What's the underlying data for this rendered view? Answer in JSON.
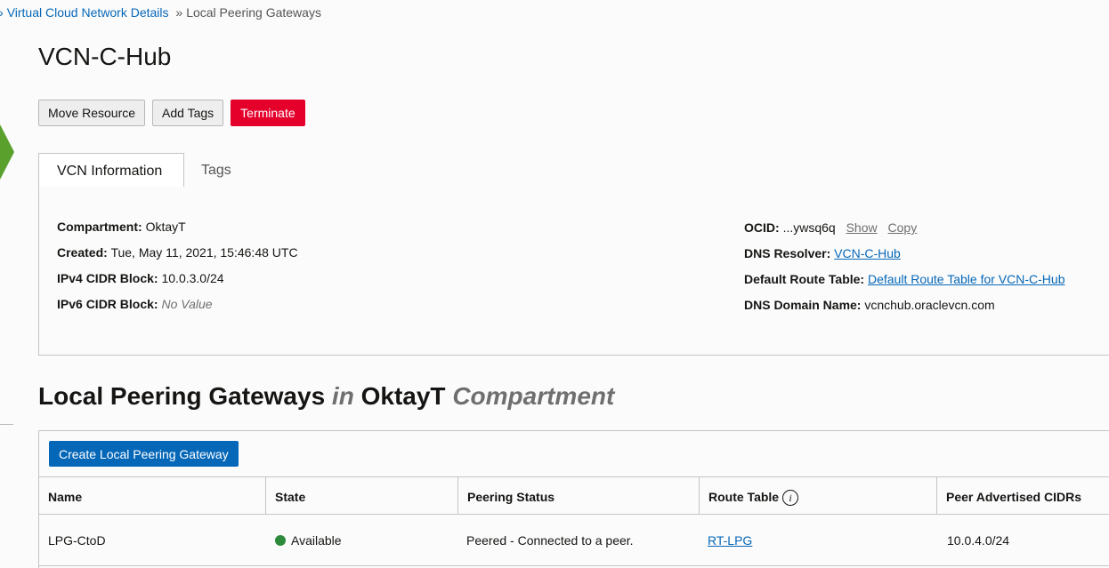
{
  "breadcrumb": {
    "prefix": "»",
    "parent": "Virtual Cloud Network Details",
    "separator": "»",
    "current": "Local Peering Gateways"
  },
  "page": {
    "title": "VCN-C-Hub"
  },
  "actions": {
    "move": "Move Resource",
    "tags": "Add Tags",
    "terminate": "Terminate"
  },
  "tabs": [
    {
      "label": "VCN Information",
      "active": true
    },
    {
      "label": "Tags",
      "active": false
    }
  ],
  "vcn_info": {
    "compartment": {
      "label": "Compartment:",
      "value": "OktayT"
    },
    "created": {
      "label": "Created:",
      "value": "Tue, May 11, 2021, 15:46:48 UTC"
    },
    "ipv4": {
      "label": "IPv4 CIDR Block:",
      "value": "10.0.3.0/24"
    },
    "ipv6": {
      "label": "IPv6 CIDR Block:",
      "value": "No Value"
    },
    "ocid": {
      "label": "OCID:",
      "value": "...ywsq6q",
      "show": "Show",
      "copy": "Copy"
    },
    "dns_resolver": {
      "label": "DNS Resolver:",
      "value": "VCN-C-Hub"
    },
    "route_table": {
      "label": "Default Route Table:",
      "value": "Default Route Table for VCN-C-Hub"
    },
    "dns_domain": {
      "label": "DNS Domain Name:",
      "value": "vcnchub.oraclevcn.com"
    }
  },
  "section": {
    "title": "Local Peering Gateways",
    "in": "in",
    "compartment": "OktayT",
    "suffix": "Compartment"
  },
  "create_button": "Create Local Peering Gateway",
  "table": {
    "columns": [
      "Name",
      "State",
      "Peering Status",
      "Route Table",
      "Peer Advertised CIDRs"
    ],
    "info_icon": "i",
    "rows": [
      {
        "name": "LPG-CtoD",
        "state": "Available",
        "peering_status": "Peered - Connected to a peer.",
        "route_table": "RT-LPG",
        "cidrs": "10.0.4.0/24"
      }
    ]
  },
  "colors": {
    "accent": "#0567b8",
    "danger": "#e4002b",
    "available": "#2c8a3a",
    "badge": "#5aa02c"
  }
}
